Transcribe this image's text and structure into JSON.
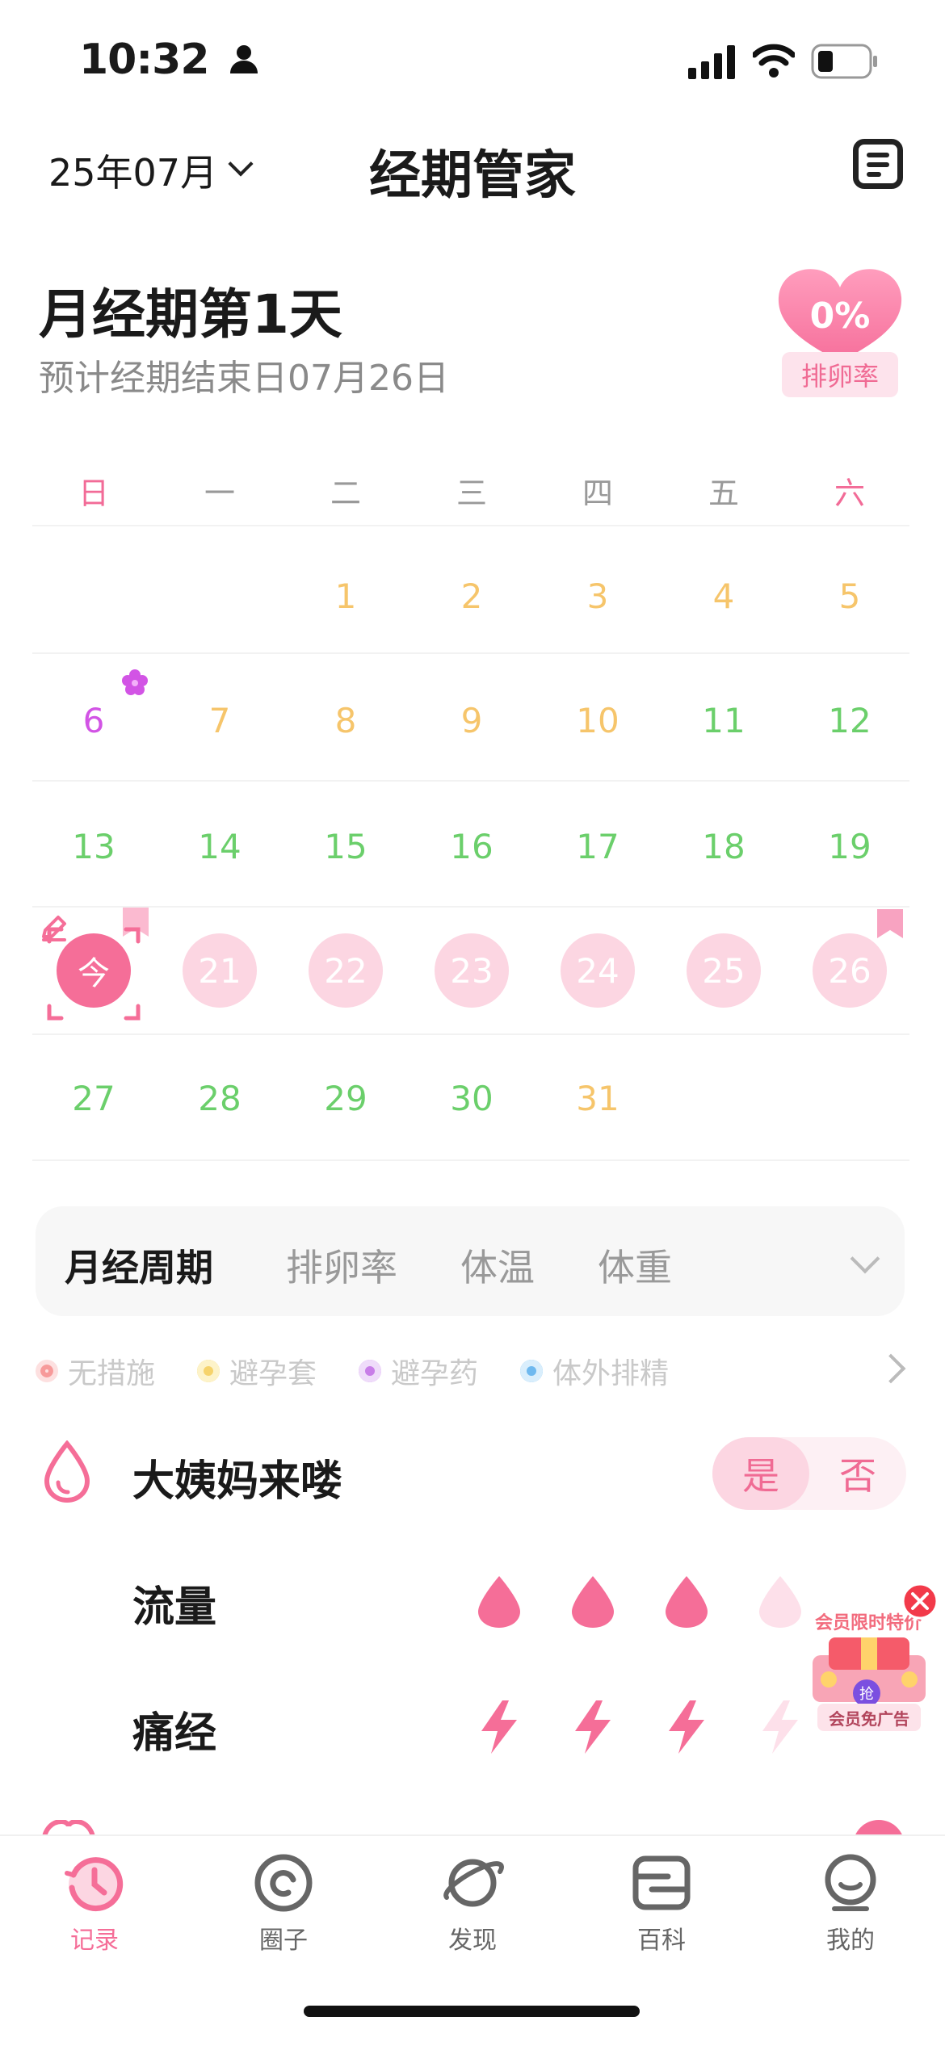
{
  "status_bar": {
    "time": "10:32"
  },
  "header": {
    "month": "25年07月",
    "title": "经期管家"
  },
  "period": {
    "day_title": "月经期第1天",
    "subtitle": "预计经期结束日07月26日",
    "ovulation_value": "0%",
    "ovulation_label": "排卵率"
  },
  "calendar": {
    "weekdays": [
      "日",
      "一",
      "二",
      "三",
      "四",
      "五",
      "六"
    ],
    "today_label": "今",
    "week1": [
      "1",
      "2",
      "3",
      "4",
      "5"
    ],
    "week2": [
      "6",
      "7",
      "8",
      "9",
      "10",
      "11",
      "12"
    ],
    "week3": [
      "13",
      "14",
      "15",
      "16",
      "17",
      "18",
      "19"
    ],
    "week4": [
      "21",
      "22",
      "23",
      "24",
      "25",
      "26"
    ],
    "week5": [
      "27",
      "28",
      "29",
      "30",
      "31"
    ]
  },
  "tabs": [
    "月经周期",
    "排卵率",
    "体温",
    "体重"
  ],
  "contraception": [
    "无措施",
    "避孕套",
    "避孕药",
    "体外排精"
  ],
  "records": {
    "period_arrived": "大姨妈来喽",
    "yes": "是",
    "no": "否",
    "flow": "流量",
    "flow_level": 3,
    "flow_max": 5,
    "pain": "痛经",
    "pain_level": 3,
    "pain_max": 5
  },
  "ad": {
    "title": "会员限时特价",
    "badge": "抢",
    "label": "会员免广告"
  },
  "nav": [
    "记录",
    "圈子",
    "发现",
    "百科",
    "我的"
  ],
  "colors": {
    "accent": "#f56e98",
    "light_pink": "#fcd6e2",
    "green": "#6bcf6b",
    "yellow": "#f6c56b",
    "magenta": "#d254e5"
  }
}
